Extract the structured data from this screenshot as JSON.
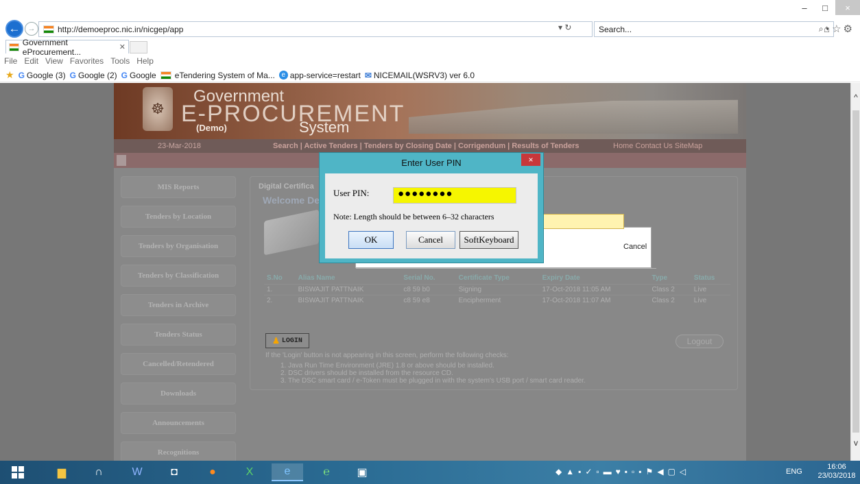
{
  "browser": {
    "url": "http://demoeproc.nic.in/nicgep/app",
    "search_placeholder": "Search...",
    "tab_title": "Government eProcurement...",
    "window_controls": {
      "minimize": "–",
      "restore": "□",
      "close": "×"
    },
    "menu": [
      "File",
      "Edit",
      "View",
      "Favorites",
      "Tools",
      "Help"
    ],
    "bookmarks": [
      "Google (3)",
      "Google (2)",
      "Google",
      "eTendering System of Ma...",
      "app-service=restart",
      "NICEMAIL(WSRV3) ver 6.0"
    ]
  },
  "site": {
    "brand_line1": "Government",
    "brand_line2": "E-PROCUREMENT",
    "brand_demo": "(Demo)",
    "brand_system": "System",
    "date": "23-Mar-2018",
    "nav_links": "Search | Active Tenders | Tenders by Closing Date | Corrigendum | Results of Tenders",
    "nav_right": "Home   Contact Us   SiteMap",
    "sidebar": [
      "MIS Reports",
      "Tenders by Location",
      "Tenders by Organisation",
      "Tenders by Classification",
      "Tenders in Archive",
      "Tenders Status",
      "Cancelled/Retendered",
      "Downloads",
      "Announcements",
      "Recognitions"
    ],
    "panel_tab": "Digital Certifica",
    "welcome": "Welcome De",
    "table": {
      "headers": [
        "S.No",
        "Alias Name",
        "Serial No.",
        "Certificate Type",
        "Expiry Date",
        "Type",
        "Status"
      ],
      "rows": [
        [
          "1.",
          "BISWAJIT PATTNAIK",
          "c8 59 b0",
          "Signing",
          "17-Oct-2018 11:05 AM",
          "Class 2",
          "Live"
        ],
        [
          "2.",
          "BISWAJIT PATTNAIK",
          "c8 59 e8",
          "Encipherment",
          "17-Oct-2018 11:07 AM",
          "Class 2",
          "Live"
        ]
      ]
    },
    "login_label": "LOGIN",
    "logout_label": "Logout",
    "checks_intro": "If the 'Login' button is not appearing in this screen, perform the following checks:",
    "checks": [
      "1.  Java Run Time Environment (JRE) 1.8 or above should be installed.",
      "2.  DSC drivers should be installed from the resource CD.",
      "3.  The DSC smart card / e-Token must be plugged in with the system's USB port / smart card reader."
    ],
    "java_cancel": "Cancel"
  },
  "dialog": {
    "title": "Enter User PIN",
    "close": "×",
    "pin_label": "User PIN:",
    "pin_value": "●●●●●●●●",
    "note": "Note: Length should be between 6–32 characters",
    "ok": "OK",
    "cancel": "Cancel",
    "softkeyboard": "SoftKeyboard"
  },
  "taskbar": {
    "lang": "ENG",
    "time": "16:06",
    "date": "23/03/2018"
  }
}
